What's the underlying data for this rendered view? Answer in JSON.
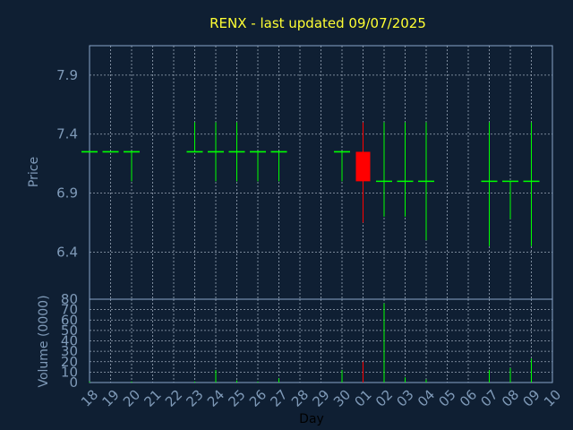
{
  "chart_data": {
    "type": "candlestick",
    "title": "RENX - last updated 09/07/2025",
    "xlabel": "Day",
    "days": [
      "18",
      "19",
      "20",
      "21",
      "22",
      "23",
      "24",
      "25",
      "26",
      "27",
      "28",
      "29",
      "30",
      "01",
      "02",
      "03",
      "04",
      "05",
      "06",
      "07",
      "08",
      "09",
      "10"
    ],
    "price": {
      "ylabel": "Price",
      "yticks": [
        "6.4",
        "6.9",
        "7.4",
        "7.9"
      ],
      "ylim": [
        6.0,
        8.15
      ],
      "candles": [
        {
          "day": "18",
          "open": 7.25,
          "high": 7.25,
          "low": 7.25,
          "close": 7.25
        },
        {
          "day": "19",
          "open": 7.25,
          "high": 7.25,
          "low": 7.25,
          "close": 7.25
        },
        {
          "day": "20",
          "open": 7.25,
          "high": 7.25,
          "low": 7.0,
          "close": 7.25
        },
        {
          "day": "23",
          "open": 7.25,
          "high": 7.5,
          "low": 7.25,
          "close": 7.25
        },
        {
          "day": "24",
          "open": 7.25,
          "high": 7.5,
          "low": 7.0,
          "close": 7.25
        },
        {
          "day": "25",
          "open": 7.25,
          "high": 7.5,
          "low": 7.0,
          "close": 7.25
        },
        {
          "day": "26",
          "open": 7.25,
          "high": 7.25,
          "low": 7.0,
          "close": 7.25
        },
        {
          "day": "27",
          "open": 7.25,
          "high": 7.25,
          "low": 7.0,
          "close": 7.25
        },
        {
          "day": "30",
          "open": 7.25,
          "high": 7.25,
          "low": 7.0,
          "close": 7.25
        },
        {
          "day": "01",
          "open": 7.25,
          "high": 7.5,
          "low": 6.65,
          "close": 7.0
        },
        {
          "day": "02",
          "open": 7.0,
          "high": 7.5,
          "low": 6.7,
          "close": 7.0
        },
        {
          "day": "03",
          "open": 7.0,
          "high": 7.5,
          "low": 6.7,
          "close": 7.0
        },
        {
          "day": "04",
          "open": 7.0,
          "high": 7.5,
          "low": 6.5,
          "close": 7.0
        },
        {
          "day": "07",
          "open": 7.0,
          "high": 7.5,
          "low": 6.45,
          "close": 7.0
        },
        {
          "day": "08",
          "open": 7.0,
          "high": 7.0,
          "low": 6.68,
          "close": 7.0
        },
        {
          "day": "09",
          "open": 7.0,
          "high": 7.5,
          "low": 6.45,
          "close": 7.0
        }
      ]
    },
    "volume": {
      "ylabel": "Volume (0000)",
      "yticks": [
        "0",
        "10",
        "20",
        "30",
        "40",
        "50",
        "60",
        "70",
        "80"
      ],
      "ylim": [
        0,
        80
      ],
      "bars": [
        {
          "day": "18",
          "value": 1
        },
        {
          "day": "20",
          "value": 1
        },
        {
          "day": "23",
          "value": 1
        },
        {
          "day": "24",
          "value": 12
        },
        {
          "day": "25",
          "value": 2
        },
        {
          "day": "26",
          "value": 1
        },
        {
          "day": "27",
          "value": 4
        },
        {
          "day": "30",
          "value": 12
        },
        {
          "day": "01",
          "value": 20
        },
        {
          "day": "02",
          "value": 76
        },
        {
          "day": "03",
          "value": 5
        },
        {
          "day": "04",
          "value": 3
        },
        {
          "day": "07",
          "value": 12
        },
        {
          "day": "08",
          "value": 14
        },
        {
          "day": "09",
          "value": 23
        }
      ]
    },
    "grid": true,
    "colors": {
      "background": "#0f1f33",
      "plot_bg": "#0f1f33",
      "axis": "#8aa6c8",
      "grid": "#9aa7b8",
      "up": "#00ff00",
      "down": "#ff0000",
      "title": "#ffff33",
      "text": "#7f9ab8"
    }
  }
}
